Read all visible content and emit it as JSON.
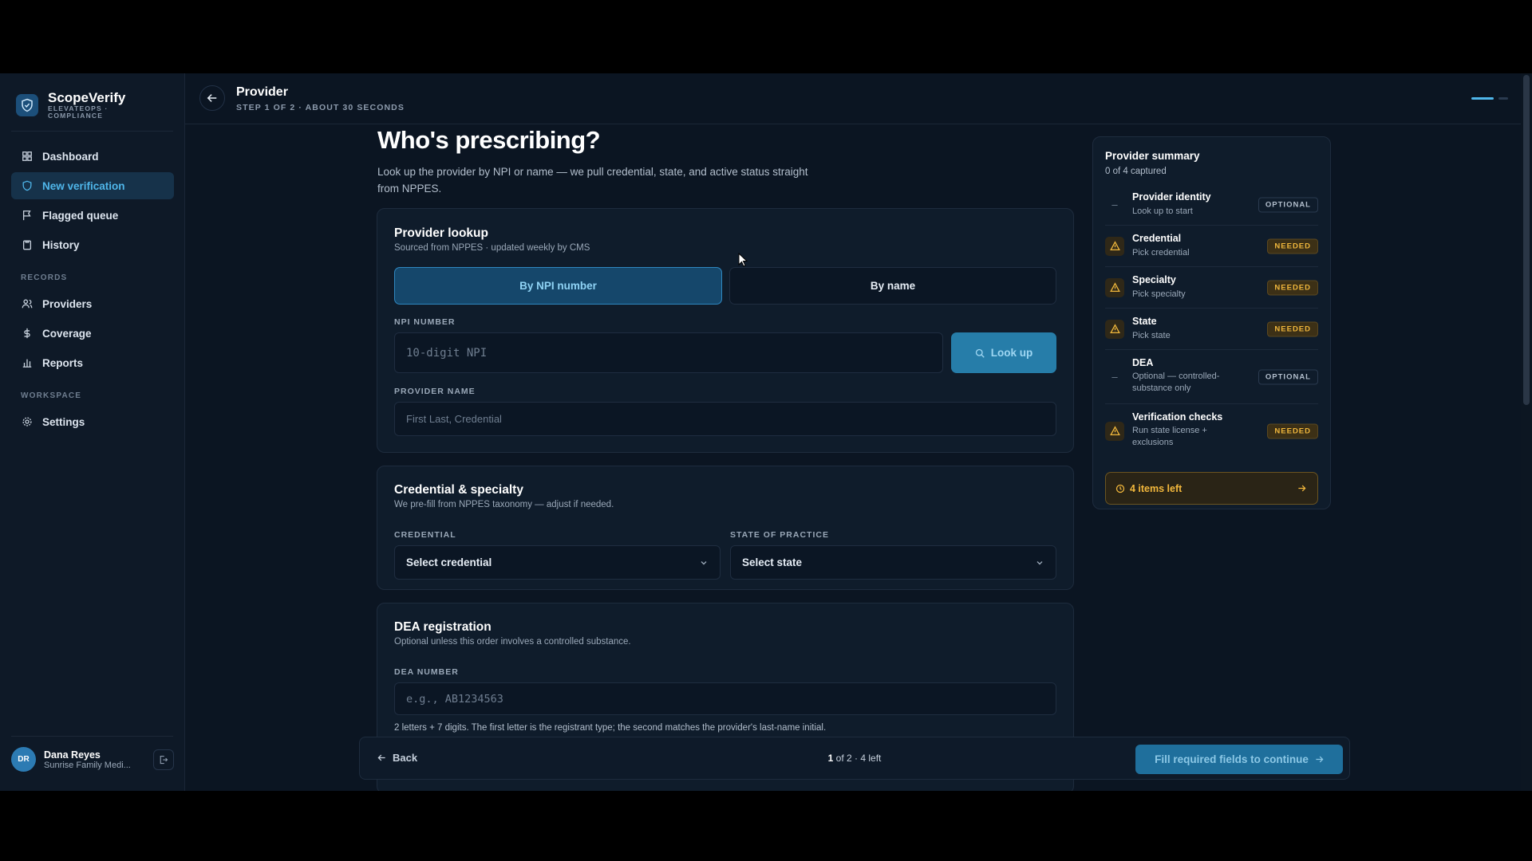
{
  "brand": {
    "name": "ScopeVerify",
    "sub": "ELEVATEOPS · COMPLIANCE"
  },
  "sidebar": {
    "main_items": [
      {
        "label": "Dashboard",
        "icon": "grid-icon"
      },
      {
        "label": "New verification",
        "icon": "shield-check-icon",
        "active": true
      },
      {
        "label": "Flagged queue",
        "icon": "flag-icon"
      },
      {
        "label": "History",
        "icon": "clipboard-icon"
      }
    ],
    "records_section": "RECORDS",
    "records_items": [
      {
        "label": "Providers",
        "icon": "users-icon"
      },
      {
        "label": "Coverage",
        "icon": "dollar-icon"
      },
      {
        "label": "Reports",
        "icon": "bar-chart-icon"
      }
    ],
    "workspace_section": "WORKSPACE",
    "workspace_items": [
      {
        "label": "Settings",
        "icon": "gear-icon"
      }
    ]
  },
  "user": {
    "initials": "DR",
    "name": "Dana Reyes",
    "org": "Sunrise Family Medi..."
  },
  "header": {
    "title": "Provider",
    "subtitle": "STEP 1 OF 2 · ABOUT 30 SECONDS"
  },
  "page": {
    "title": "Who's prescribing?",
    "description": "Look up the provider by NPI or name — we pull credential, state, and active status straight from NPPES."
  },
  "lookup_card": {
    "title": "Provider lookup",
    "subtitle": "Sourced from NPPES · updated weekly by CMS",
    "tab_npi": "By NPI number",
    "tab_name": "By name",
    "npi_label": "NPI NUMBER",
    "npi_placeholder": "10-digit NPI",
    "lookup_button": "Look up",
    "name_label": "PROVIDER NAME",
    "name_placeholder": "First Last, Credential"
  },
  "credential_card": {
    "title": "Credential & specialty",
    "subtitle": "We pre-fill from NPPES taxonomy — adjust if needed.",
    "credential_label": "CREDENTIAL",
    "credential_value": "Select credential",
    "state_label": "STATE OF PRACTICE",
    "state_value": "Select state"
  },
  "dea_card": {
    "title": "DEA registration",
    "subtitle": "Optional unless this order involves a controlled substance.",
    "dea_label": "DEA NUMBER",
    "dea_placeholder": "e.g., AB1234563",
    "hint": "2 letters + 7 digits. The first letter is the registrant type; the second matches the provider's last-name initial."
  },
  "footer": {
    "back": "Back",
    "step_current": "1",
    "step_rest": " of 2 · 4 left",
    "continue": "Fill required fields to continue"
  },
  "summary": {
    "title": "Provider summary",
    "subtitle": "0 of 4 captured",
    "rows": [
      {
        "name": "Provider identity",
        "desc": "Look up to start",
        "status": "OPTIONAL"
      },
      {
        "name": "Credential",
        "desc": "Pick credential",
        "status": "NEEDED"
      },
      {
        "name": "Specialty",
        "desc": "Pick specialty",
        "status": "NEEDED"
      },
      {
        "name": "State",
        "desc": "Pick state",
        "status": "NEEDED"
      },
      {
        "name": "DEA",
        "desc": "Optional — controlled-substance only",
        "status": "OPTIONAL"
      },
      {
        "name": "Verification checks",
        "desc": "Run state license + exclusions",
        "status": "NEEDED"
      }
    ],
    "items_left": "4 items left"
  },
  "colors": {
    "accent": "#4fb6ea",
    "warning": "#f0b73c",
    "background": "#0b1522"
  }
}
